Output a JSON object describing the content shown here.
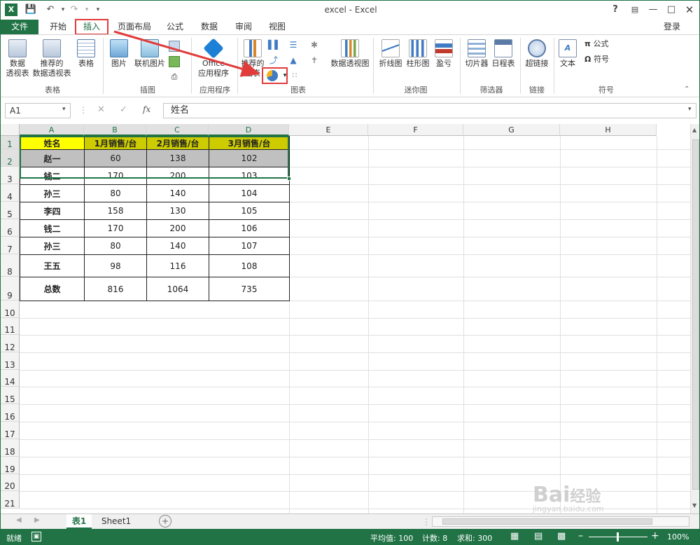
{
  "window": {
    "title": "excel - Excel",
    "help": "?",
    "login": "登录"
  },
  "tabs": [
    "文件",
    "开始",
    "插入",
    "页面布局",
    "公式",
    "数据",
    "审阅",
    "视图"
  ],
  "ribbon": {
    "pivot": "数据\n透视表",
    "rec_pivot": "推荐的\n数据透视表",
    "table": "表格",
    "group_table": "表格",
    "picture": "图片",
    "online_picture": "联机图片",
    "group_illus": "插图",
    "office_app": "Office\n应用程序",
    "group_apps": "应用程序",
    "rec_chart": "推荐的\n图表",
    "group_charts": "图表",
    "pivot_chart": "数据透视图",
    "spark_line": "折线图",
    "spark_col": "柱形图",
    "spark_wl": "盈亏",
    "group_spark": "迷你图",
    "slicer": "切片器",
    "timeline": "日程表",
    "group_filter": "筛选器",
    "hyperlink": "超链接",
    "group_links": "链接",
    "text": "文本",
    "equation": "公式",
    "symbol": "符号",
    "group_symbols": "符号"
  },
  "formula_bar": {
    "name_box": "A1",
    "fx": "fx",
    "content": "姓名"
  },
  "columns": [
    "A",
    "B",
    "C",
    "D",
    "E",
    "F",
    "G",
    "H"
  ],
  "rows": [
    "1",
    "2",
    "3",
    "4",
    "5",
    "6",
    "7",
    "8",
    "9",
    "10",
    "11",
    "12",
    "13",
    "14",
    "15",
    "16",
    "17",
    "18",
    "19",
    "20",
    "21"
  ],
  "table": {
    "headers": [
      "姓名",
      "1月销售/台",
      "2月销售/台",
      "3月销售/台"
    ],
    "data": [
      [
        "赵一",
        "60",
        "138",
        "102"
      ],
      [
        "钱二",
        "170",
        "200",
        "103"
      ],
      [
        "孙三",
        "80",
        "140",
        "104"
      ],
      [
        "李四",
        "158",
        "130",
        "105"
      ],
      [
        "钱二",
        "170",
        "200",
        "106"
      ],
      [
        "孙三",
        "80",
        "140",
        "107"
      ],
      [
        "王五",
        "98",
        "116",
        "108"
      ],
      [
        "总数",
        "816",
        "1064",
        "735"
      ]
    ]
  },
  "sheets": [
    "表1",
    "Sheet1"
  ],
  "status": {
    "ready": "就绪",
    "average": "平均值: 100",
    "count": "计数: 8",
    "sum": "求和: 300",
    "zoom": "100%"
  },
  "watermark": {
    "text1": "Bai",
    "text2": "经验",
    "url": "jingyan.baidu.com"
  },
  "colors": {
    "accent": "#217346",
    "header_yellow": "#ffff00",
    "header_olive": "#cccc00",
    "row_gray": "#c0c0c0",
    "annotation": "#e23b3b"
  }
}
